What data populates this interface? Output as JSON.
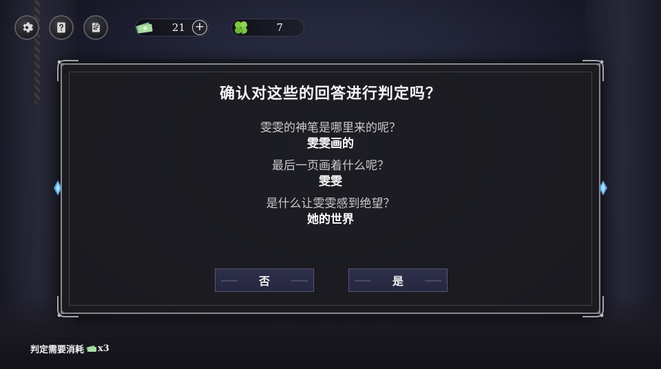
{
  "hud": {
    "notes_count": "21",
    "clover_count": "7",
    "plus_label": "+"
  },
  "dialog": {
    "title": "确认对这些的回答进行判定吗？",
    "qa": [
      {
        "question": "雯雯的神笔是哪里来的呢？",
        "answer": "雯雯画的"
      },
      {
        "question": "最后一页画着什么呢？",
        "answer": "雯雯"
      },
      {
        "question": "是什么让雯雯感到绝望？",
        "answer": "她的世界"
      }
    ],
    "no_label": "否",
    "yes_label": "是"
  },
  "footer": {
    "cost_prefix": "判定需要消耗",
    "cost_suffix": "x3"
  },
  "icons": {
    "settings": "gear-icon",
    "help": "question-card-icon",
    "log": "notebook-icon",
    "notes": "money-notes-icon",
    "clover": "four-leaf-clover-icon"
  },
  "colors": {
    "dialog_bg": "#1b1b1f",
    "button_bg": "#2a2b45",
    "clover": "#7ec843",
    "notes": "#9fd39a"
  }
}
